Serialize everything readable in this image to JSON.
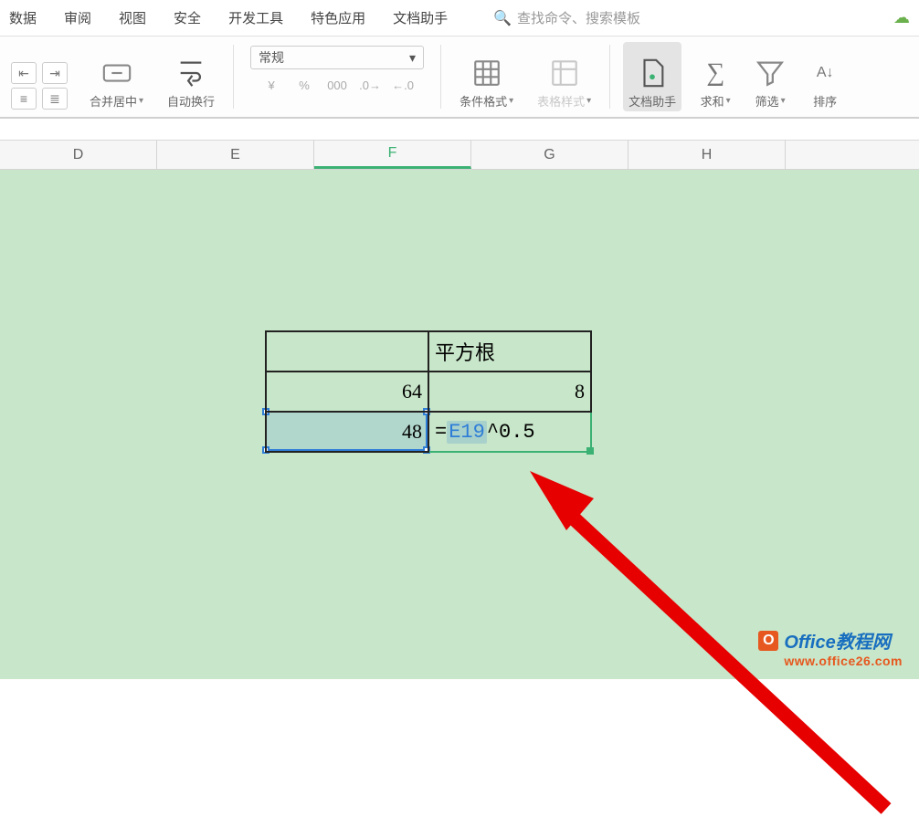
{
  "tabs": [
    "数据",
    "审阅",
    "视图",
    "安全",
    "开发工具",
    "特色应用",
    "文档助手"
  ],
  "search_placeholder": "查找命令、搜索模板",
  "format_select": "常规",
  "ribbon": {
    "merge": "合并居中",
    "wrap": "自动换行",
    "cond_format": "条件格式",
    "table_style": "表格样式",
    "doc_helper": "文档助手",
    "sum": "求和",
    "filter": "筛选",
    "sort": "排序"
  },
  "columns": [
    "D",
    "E",
    "F",
    "G",
    "H"
  ],
  "active_col_index": 2,
  "table": {
    "header_e": "",
    "header_f": "平方根",
    "row1_e": "64",
    "row1_f": "8",
    "row2_e": "48",
    "formula_prefix": "=",
    "formula_ref": "E19",
    "formula_suffix": "^0.5"
  },
  "watermark": {
    "brand": "Office教程网",
    "url": "www.office26.com"
  }
}
